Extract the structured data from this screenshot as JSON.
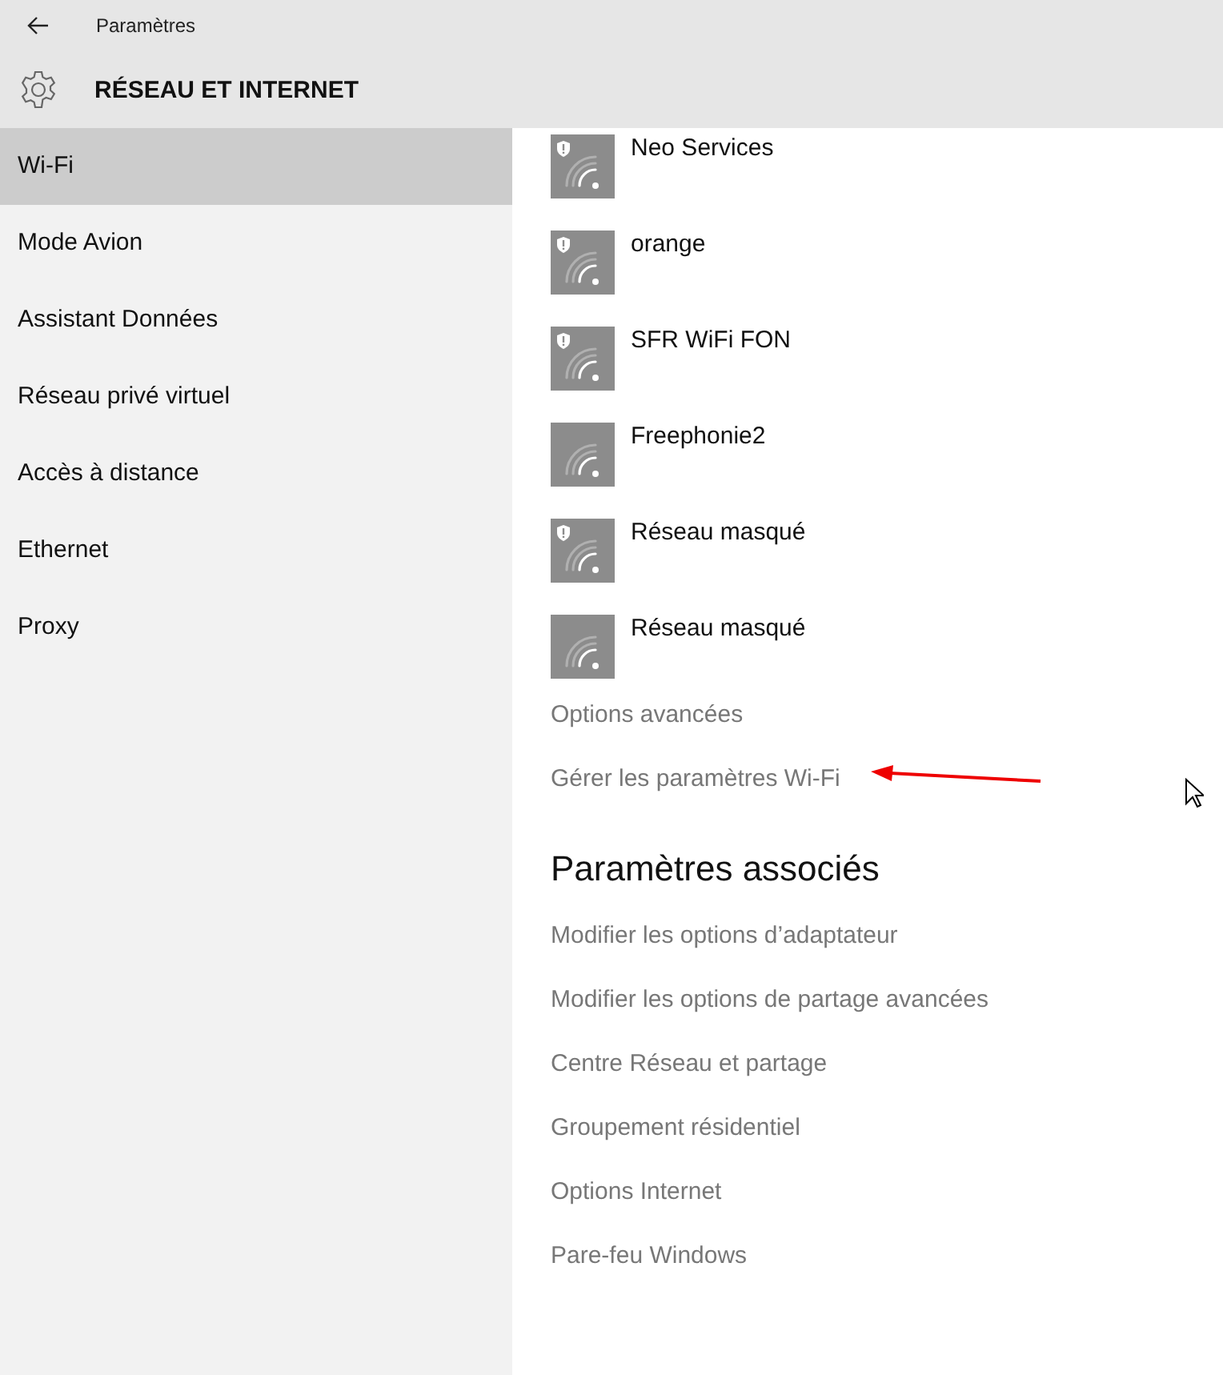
{
  "window": {
    "title": "Paramètres"
  },
  "header": {
    "title": "RÉSEAU ET INTERNET"
  },
  "sidebar": {
    "items": [
      {
        "label": "Wi-Fi",
        "selected": true
      },
      {
        "label": "Mode Avion",
        "selected": false
      },
      {
        "label": "Assistant Données",
        "selected": false
      },
      {
        "label": "Réseau privé virtuel",
        "selected": false
      },
      {
        "label": "Accès à distance",
        "selected": false
      },
      {
        "label": "Ethernet",
        "selected": false
      },
      {
        "label": "Proxy",
        "selected": false
      }
    ]
  },
  "networks": [
    {
      "name": "Neo Services",
      "secured": true
    },
    {
      "name": "orange",
      "secured": true
    },
    {
      "name": "SFR WiFi FON",
      "secured": true
    },
    {
      "name": "Freephonie2",
      "secured": false
    },
    {
      "name": "Réseau masqué",
      "secured": true
    },
    {
      "name": "Réseau masqué",
      "secured": false
    }
  ],
  "wifi_links": [
    "Options avancées",
    "Gérer les paramètres Wi-Fi"
  ],
  "related": {
    "title": "Paramètres associés",
    "links": [
      "Modifier les options d’adaptateur",
      "Modifier les options de partage avancées",
      "Centre Réseau et partage",
      "Groupement résidentiel",
      "Options Internet",
      "Pare-feu Windows"
    ]
  }
}
